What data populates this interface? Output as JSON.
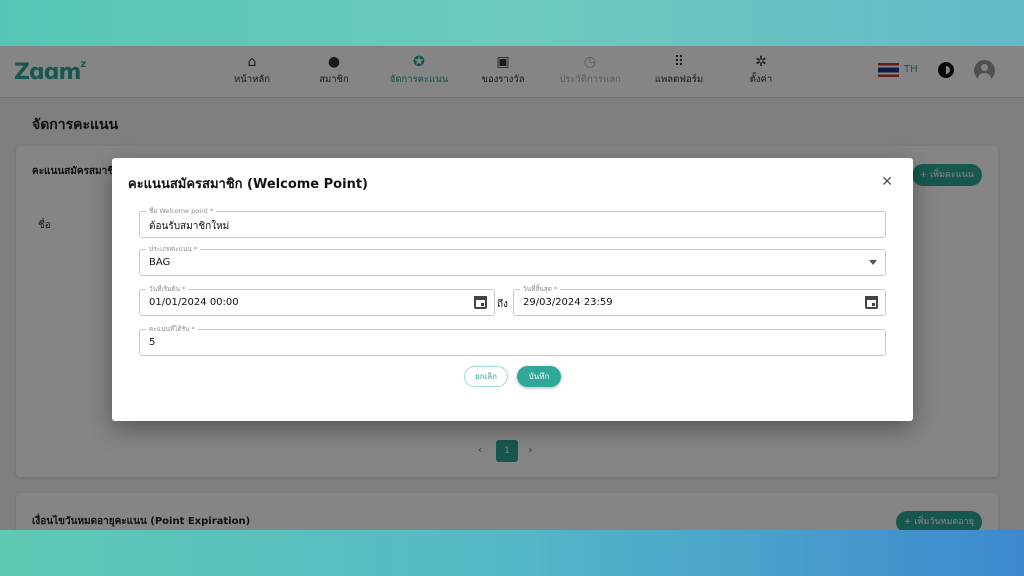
{
  "brand": {
    "logo": "Z",
    "logo_eyes": "ɑɑ",
    "logo_tail": "m",
    "logo_sup": "z"
  },
  "nav": {
    "items": [
      {
        "label": "หน้าหลัก",
        "icon": "home-icon",
        "glyph": "⌂"
      },
      {
        "label": "สมาชิก",
        "icon": "person-icon",
        "glyph": "●"
      },
      {
        "label": "จัดการคะแนน",
        "icon": "star-badge-icon",
        "glyph": "✪"
      },
      {
        "label": "ของรางวัล",
        "icon": "gift-icon",
        "glyph": "▣"
      },
      {
        "label": "ประวัติการแลก",
        "icon": "history-icon",
        "glyph": "◷"
      },
      {
        "label": "แพลตฟอร์ม",
        "icon": "grid-icon",
        "glyph": "⠿"
      },
      {
        "label": "ตั้งค่า",
        "icon": "gear-icon",
        "glyph": "✲"
      }
    ],
    "lang": "TH",
    "colors": {
      "active": "#1d9d8f",
      "disabled": "#b3b3b3"
    }
  },
  "page": {
    "title": "จัดการคะแนน",
    "welcome_card": {
      "title": "คะแนนสมัครสมาชิก",
      "add_button": "+ เพิ่มคะแนน",
      "col_name": "ชื่อ"
    },
    "pagination": {
      "prev": "‹",
      "current": "1",
      "next": "›"
    },
    "expiration_card": {
      "title": "เงื่อนไขวันหมดอายุคะแนน (Point Expiration)",
      "add_button": "+ เพิ่มวันหมดอายุ"
    }
  },
  "modal": {
    "title": "คะแนนสมัครสมาชิก (Welcome Point)",
    "close": "✕",
    "fields": {
      "name": {
        "label": "ชื่อ Welcome point *",
        "value": "ต้อนรับสมาชิกใหม่"
      },
      "type": {
        "label": "ประเภทคะแนน *",
        "value": "BAG"
      },
      "start": {
        "label": "วันที่เริ่มต้น *",
        "value": "01/01/2024 00:00"
      },
      "to": "ถึง",
      "end": {
        "label": "วันที่สิ้นสุด *",
        "value": "29/03/2024 23:59"
      },
      "points": {
        "label": "คะแนนที่ได้รับ *",
        "value": "5"
      }
    },
    "cancel": "ยกเลิก",
    "save": "บันทึก"
  },
  "theme": {
    "accent": "#2fa89a",
    "overlay": "rgba(0,0,0,0.48)"
  }
}
